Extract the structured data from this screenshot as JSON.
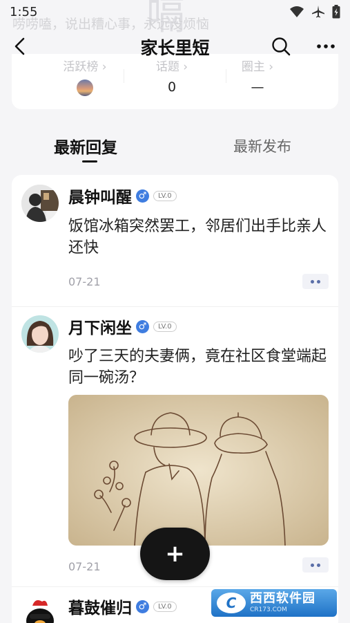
{
  "status": {
    "time": "1:55"
  },
  "background": {
    "tagline": "唠唠嗑，说出糟心事，永远没烦恼",
    "big_char": "嗝"
  },
  "nav": {
    "title": "家长里短"
  },
  "stats": [
    {
      "label": "活跃榜 ›",
      "value": ""
    },
    {
      "label": "话题 ›",
      "value": "0"
    },
    {
      "label": "圈主 ›",
      "value": "—"
    }
  ],
  "tabs": {
    "active": "最新回复",
    "inactive": "最新发布"
  },
  "posts": [
    {
      "username": "晨钟叫醒",
      "gender": "♂",
      "level": "LV.0",
      "title": "饭馆冰箱突然罢工，邻居们出手比亲人还快",
      "date": "07-21"
    },
    {
      "username": "月下闲坐",
      "gender": "♂",
      "level": "LV.0",
      "title": "吵了三天的夫妻俩，竟在社区食堂端起同一碗汤？",
      "date": "07-21"
    },
    {
      "username": "暮鼓催归",
      "gender": "♂",
      "level": "LV.0"
    }
  ],
  "fab": {
    "label": "+"
  },
  "watermark": {
    "logo": "C",
    "main": "西西软件园",
    "sub": "CR173.COM"
  },
  "colors": {
    "accent": "#3f7de0",
    "fab": "#151515",
    "more_dot": "#5a6ea8"
  }
}
